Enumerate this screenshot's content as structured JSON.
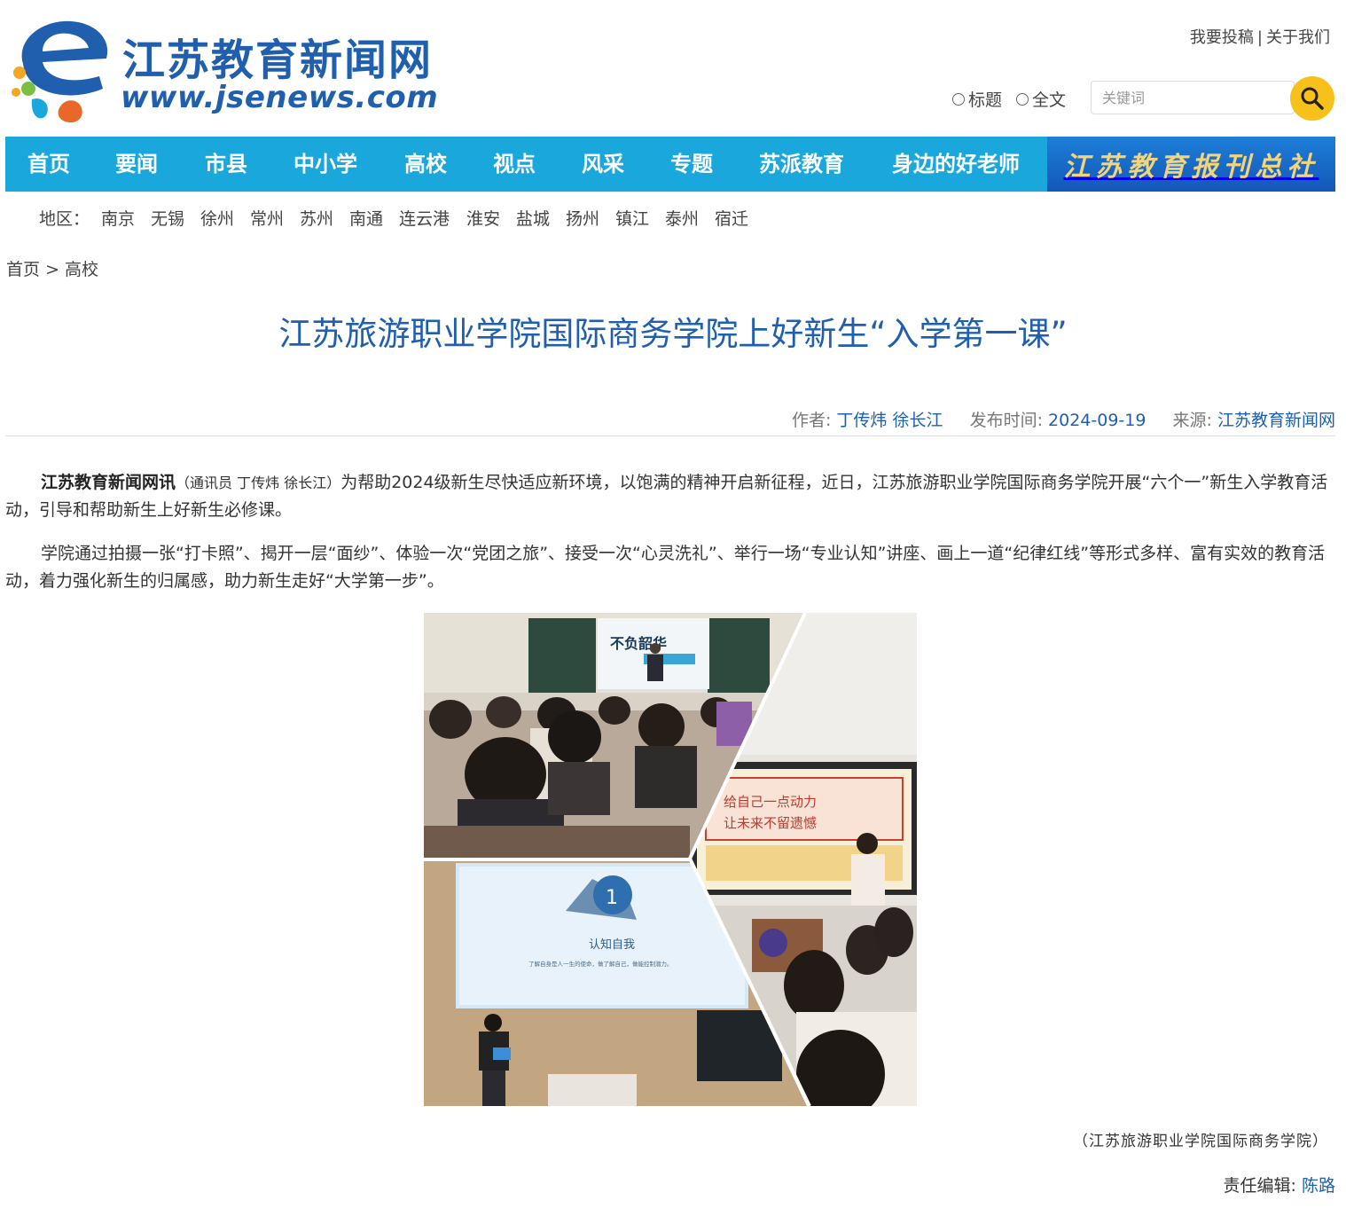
{
  "header": {
    "logo_title": "江苏教育新闻网",
    "logo_url": "www.jsenews.com",
    "top_links": [
      "我要投稿",
      "关于我们"
    ],
    "search": {
      "options": [
        "标题",
        "全文"
      ],
      "placeholder": "关键词",
      "button_icon": "search-icon"
    }
  },
  "nav": {
    "items": [
      "首页",
      "要闻",
      "市县",
      "中小学",
      "高校",
      "视点",
      "风采",
      "专题",
      "苏派教育",
      "身边的好老师"
    ],
    "banner": "江苏教育报刊总社",
    "bg_color": "#1aa8dc"
  },
  "region": {
    "label": "地区：",
    "cities": [
      "南京",
      "无锡",
      "徐州",
      "常州",
      "苏州",
      "南通",
      "连云港",
      "淮安",
      "盐城",
      "扬州",
      "镇江",
      "泰州",
      "宿迁"
    ]
  },
  "breadcrumb": {
    "home": "首页",
    "separator": ">",
    "current": "高校"
  },
  "article": {
    "title": "江苏旅游职业学院国际商务学院上好新生“入学第一课”",
    "meta": {
      "author_label": "作者:",
      "author": "丁传炜 徐长江",
      "date_label": "发布时间:",
      "date": "2024-09-19",
      "source_label": "来源:",
      "source": "江苏教育新闻网"
    },
    "lead_bold": "江苏教育新闻网讯",
    "lead_note": "（通讯员 丁传炜 徐长江）",
    "lead_text": "为帮助2024级新生尽快适应新环境，以饱满的精神开启新征程，近日，江苏旅游职业学院国际商务学院开展“六个一”新生入学教育活动，引导和帮助新生上好新生必修课。",
    "para2": "学院通过拍摄一张“打卡照”、揭开一层“面纱”、体验一次“党团之旅”、接受一次“心灵洗礼”、举行一场“专业认知”讲座、画上一道“纪律红线”等形式多样、富有实效的教育活动，着力强化新生的归属感，助力新生走好“大学第一步”。",
    "figure": {
      "slide_top": "不负韶华",
      "board_line1": "给自己一点动力",
      "board_line2": "让未来不留遗憾",
      "slide_number": "1",
      "slide_heading": "认知自我",
      "slide_sub": "了解自身是人一生的使命，做了解自己，做能控制潜力。"
    },
    "caption": "（江苏旅游职业学院国际商务学院）",
    "editor_label": "责任编辑:",
    "editor": "陈路"
  }
}
